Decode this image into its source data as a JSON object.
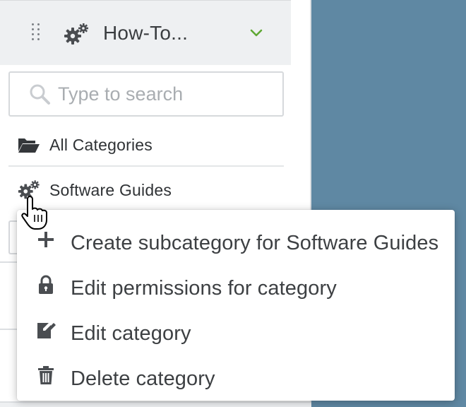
{
  "sidebar": {
    "header": {
      "title": "How-To...",
      "drag_handle_icon": "drag-handle-icon",
      "category_icon": "gears-icon",
      "expand_icon": "chevron-down-icon",
      "expand_color": "#5fa834"
    },
    "search": {
      "placeholder": "Type to search",
      "value": ""
    },
    "categories": [
      {
        "label": "All Categories",
        "icon": "folder-open-icon"
      },
      {
        "label": "Software Guides",
        "icon": "gears-icon"
      }
    ]
  },
  "context_menu": {
    "items": [
      {
        "label": "Create subcategory for Software Guides",
        "icon": "plus-icon"
      },
      {
        "label": "Edit permissions for category",
        "icon": "lock-icon"
      },
      {
        "label": "Edit category",
        "icon": "edit-icon"
      },
      {
        "label": "Delete category",
        "icon": "trash-icon"
      }
    ]
  },
  "colors": {
    "backdrop": "#5f88a3",
    "header_bg": "#eef0f2",
    "accent_green": "#5fa834"
  }
}
